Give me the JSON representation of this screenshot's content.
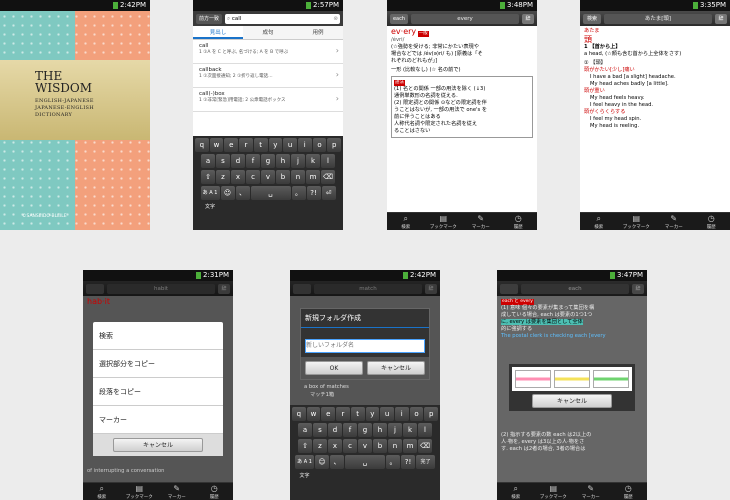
{
  "s1": {
    "time": "2:42PM",
    "title_line1": "THE",
    "title_line2": "WISDOM",
    "subtitle": [
      "ENGLISH-JAPANESE",
      "JAPANESE-ENGLISH",
      "DICTIONARY"
    ],
    "copyright": "©SANSEIDO-BLEILE"
  },
  "s2": {
    "time": "2:57PM",
    "mode": "前方一致",
    "query": "call",
    "tabs": [
      "見出し",
      "成句",
      "用例"
    ],
    "items": [
      {
        "word": "call",
        "def": "1 ①A を C と呼ぶ, 名づける; A を B で呼ぶ"
      },
      {
        "word": "callback",
        "def": "1 ①次面接通知; 2 ①折り返し電話…"
      },
      {
        "word": "call(-)box",
        "def": "1 ①非常[緊急]用電話; 2 公衆電話ボックス"
      }
    ]
  },
  "s3": {
    "time": "3:48PM",
    "back": "each",
    "title": "every",
    "headword": "ev·ery",
    "pron": "/évri/",
    "line1": "(☆強勢を受ける; 非常にかたい表現や",
    "line2": "場合などでは /év(ə)ri/ も) [原義は「そ",
    "line3": "れぞれのどれもが」]",
    "pos": "一形 (比較なし) (☆ 名の前で)",
    "sense1": "(1) 名との関係 一部の用法を除く (↓3)",
    "sense1b": "通例単数形の名詞を従える.",
    "sense2": "(2) 限定詞との関係 ⊙などの限定詞を伴",
    "sense2b": "うことはないが, 一部の用法で one's を",
    "sense2c": "前に伴うことはある",
    "sense2d": "人称代名詞や限定された名詞を従え",
    "sense2e": "ることはさない"
  },
  "s4": {
    "time": "3:35PM",
    "back": "検索",
    "title": "あたま[頭]",
    "kana": "あたま",
    "kanji": "頭",
    "sense": "1 【首から上】",
    "def": "a head, (☆顔も含む首から上全体をさす)",
    "sub": "① 【頭】",
    "ex1": "頭がかたい[少し]痛い",
    "ex1e1": "I have a bad [a slight] headache.",
    "ex1e2": "My head aches badly [a little].",
    "ex2": "頭が重い",
    "ex2e1": "My head feels heavy.",
    "ex2e2": "I feel heavy in the head.",
    "ex3": "頭がくらくらする",
    "ex3e1": "I feel my head spin.",
    "ex3e2": "My head is reeling."
  },
  "s5": {
    "time": "2:31PM",
    "headword": "hab·it",
    "menu": [
      "検索",
      "選択部分をコピー",
      "段落をコピー",
      "マーカー"
    ],
    "cancel": "キャンセル",
    "under": "of interrupting a conversation"
  },
  "s6": {
    "time": "2:42PM",
    "title": "新規フォルダ作成",
    "placeholder": "新しいフォルダ名",
    "ok": "OK",
    "cancel": "キャンセル",
    "under1": "a box of matches",
    "under2": "マッチ1箱"
  },
  "s7": {
    "time": "3:47PM",
    "title": "each",
    "tag": "each と every",
    "body1": "(1) 意味 個々の要素が集まって集団を構",
    "body2": "成している場合, each は要素の1つ1つ",
    "body3": "に, every は要素を集団として全体",
    "body4": "的に強調する",
    "example": "The postal clerk is checking each [every",
    "cancel": "キャンセル",
    "body5": "(2) 指示する要素の数 each は2以上の",
    "body6": "人·物を, every は3以上の人·物をさ",
    "body7": "す. each は2者の場合, 3者の場合は"
  },
  "nav": [
    "検索",
    "ブックマーク",
    "マーカー",
    "履歴"
  ],
  "kb": {
    "row1": [
      "q",
      "w",
      "e",
      "r",
      "t",
      "y",
      "u",
      "i",
      "o",
      "p"
    ],
    "row2": [
      "a",
      "s",
      "d",
      "f",
      "g",
      "h",
      "j",
      "k",
      "l"
    ],
    "row3": [
      "⇧",
      "z",
      "x",
      "c",
      "v",
      "b",
      "n",
      "m",
      "⌫"
    ],
    "row4": [
      "あ A 1 文字",
      "☺",
      "、",
      "␣",
      "。",
      "?!",
      "⏎"
    ],
    "done": "完了"
  }
}
